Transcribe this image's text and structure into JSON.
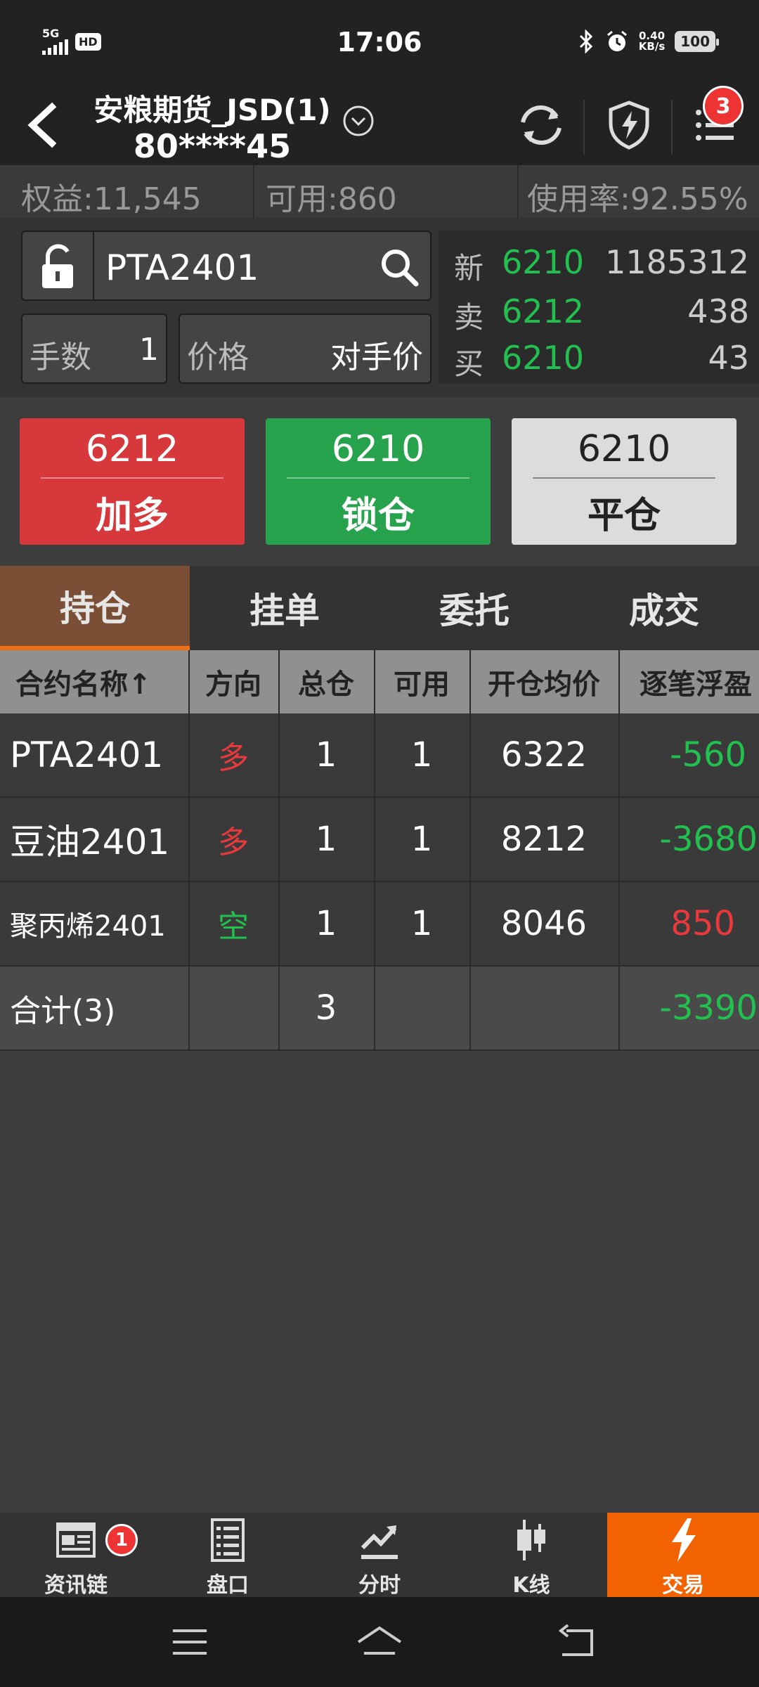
{
  "status_bar": {
    "network": "5G",
    "hd": "HD",
    "time": "17:06",
    "speed_value": "0.40",
    "speed_unit": "KB/s",
    "battery": "100"
  },
  "header": {
    "account_name": "安粮期货_JSD(1)",
    "account_id": "80****45",
    "menu_badge": "3"
  },
  "info": {
    "equity": "权益:11,545",
    "available": "可用:860",
    "usage": "使用率:92.55%"
  },
  "order": {
    "symbol": "PTA2401",
    "qty_label": "手数",
    "qty_value": "1",
    "price_label": "价格",
    "price_value": "对手价"
  },
  "quote": {
    "rows": [
      {
        "label": "新",
        "price": "6210",
        "volume": "1185312"
      },
      {
        "label": "卖",
        "price": "6212",
        "volume": "438"
      },
      {
        "label": "买",
        "price": "6210",
        "volume": "43"
      }
    ]
  },
  "actions": [
    {
      "price": "6212",
      "label": "加多"
    },
    {
      "price": "6210",
      "label": "锁仓"
    },
    {
      "price": "6210",
      "label": "平仓"
    }
  ],
  "tabs": [
    "持仓",
    "挂单",
    "委托",
    "成交"
  ],
  "table": {
    "headers": [
      "合约名称↑",
      "方向",
      "总仓",
      "可用",
      "开仓均价",
      "逐笔浮盈"
    ],
    "rows": [
      {
        "name": "PTA2401",
        "dir": "多",
        "total": "1",
        "avail": "1",
        "avg": "6322",
        "pnl": "-560"
      },
      {
        "name": "豆油2401",
        "dir": "多",
        "total": "1",
        "avail": "1",
        "avg": "8212",
        "pnl": "-3680"
      },
      {
        "name": "聚丙烯2401",
        "dir": "空",
        "total": "1",
        "avail": "1",
        "avg": "8046",
        "pnl": "850"
      }
    ],
    "total_row": {
      "name": "合计(3)",
      "total": "3",
      "pnl": "-3390"
    }
  },
  "colors": {
    "up_red": "#e8393c",
    "down_green": "#22c04f",
    "accent_orange": "#f26200"
  },
  "bottom_nav": {
    "items": [
      {
        "label": "资讯链",
        "icon": "news-icon",
        "badge": "1"
      },
      {
        "label": "盘口",
        "icon": "orderbook-icon"
      },
      {
        "label": "分时",
        "icon": "timeshare-icon"
      },
      {
        "label": "K线",
        "icon": "candlestick-icon"
      },
      {
        "label": "交易",
        "icon": "lightning-icon"
      }
    ]
  }
}
